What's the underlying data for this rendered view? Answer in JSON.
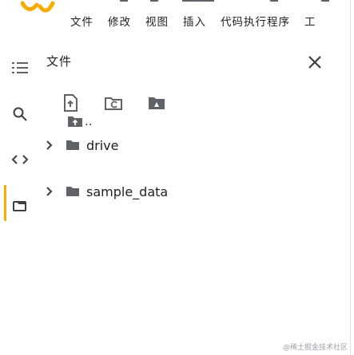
{
  "menubar": {
    "items": [
      "文件",
      "修改",
      "视图",
      "插入",
      "代码执行程序",
      "工"
    ]
  },
  "sidebar": {
    "icons": [
      "menu-icon",
      "search-icon",
      "code-icon",
      "folder-icon"
    ],
    "active": "folder-icon"
  },
  "panel": {
    "title": "文件",
    "toolbar": [
      "upload-file-icon",
      "refresh-icon",
      "mount-drive-icon"
    ],
    "parent_label": "..",
    "tree": [
      {
        "label": "drive",
        "icon": "folder-icon",
        "expanded": false
      },
      {
        "label": "sample_data",
        "icon": "folder-icon",
        "expanded": false
      }
    ]
  },
  "colors": {
    "logo_orange": "#f9ab00",
    "icon_gray": "#5f6368",
    "text": "#202124"
  },
  "watermark": "@稀土掘金技术社区"
}
